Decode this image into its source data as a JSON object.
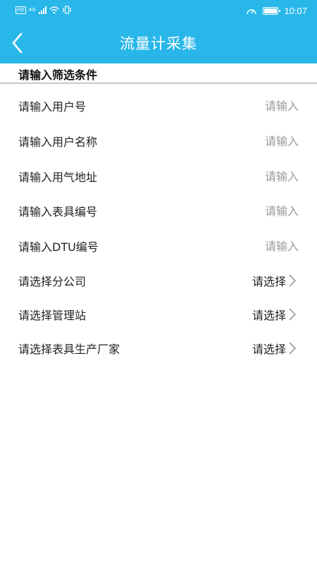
{
  "status_bar": {
    "hd_badge": "HD",
    "network_type": "4G",
    "time": "10:07"
  },
  "header": {
    "title": "流量计采集",
    "back_icon": "chevron-left-icon",
    "background_color": "#29b7ea"
  },
  "filter": {
    "section_title": "请输入筛选条件",
    "inputs": [
      {
        "label": "请输入用户号",
        "placeholder": "请输入",
        "value": ""
      },
      {
        "label": "请输入用户名称",
        "placeholder": "请输入",
        "value": ""
      },
      {
        "label": "请输入用气地址",
        "placeholder": "请输入",
        "value": ""
      },
      {
        "label": "请输入表具编号",
        "placeholder": "请输入",
        "value": ""
      },
      {
        "label": "请输入DTU编号",
        "placeholder": "请输入",
        "value": ""
      }
    ],
    "selects": [
      {
        "label": "请选择分公司",
        "value": "请选择",
        "icon": "chevron-right-icon"
      },
      {
        "label": "请选择管理站",
        "value": "请选择",
        "icon": "chevron-right-icon"
      },
      {
        "label": "请选择表具生产厂家",
        "value": "请选择",
        "icon": "chevron-right-icon"
      }
    ]
  }
}
